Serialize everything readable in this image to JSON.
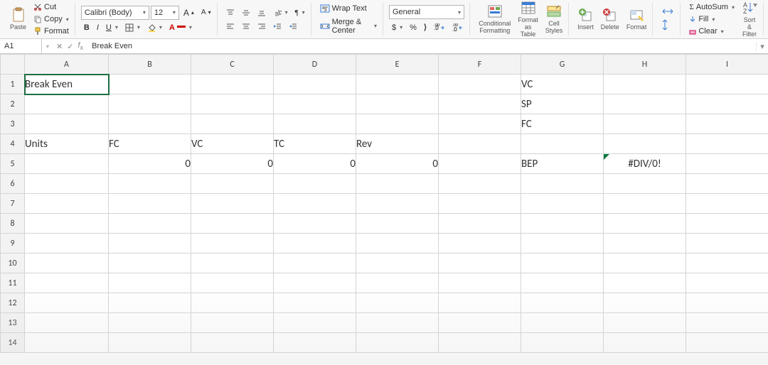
{
  "ribbon": {
    "clipboard": {
      "paste": "Paste",
      "cut": "Cut",
      "copy": "Copy",
      "format": "Format"
    },
    "font": {
      "name": "Calibri (Body)",
      "size": "12",
      "bold": "B",
      "italic": "I",
      "underline": "U",
      "increase": "A▴",
      "decrease": "A▾"
    },
    "align": {
      "wrap": "Wrap Text",
      "merge": "Merge & Center"
    },
    "number": {
      "format": "General",
      "currency": "$",
      "percent": "%",
      "comma": ",",
      "inc": ".00→.0",
      "dec": ".0→.00"
    },
    "styles": {
      "cond": "Conditional",
      "cond2": "Formatting",
      "fat": "Format",
      "fat2": "as Table",
      "cs": "Cell",
      "cs2": "Styles"
    },
    "cells": {
      "insert": "Insert",
      "delete": "Delete",
      "format": "Format"
    },
    "editing": {
      "autosum": "AutoSum",
      "fill": "Fill",
      "clear": "Clear",
      "sort": "Sort &",
      "filter": "Filter"
    }
  },
  "formula": {
    "cellref": "A1",
    "value": "Break Even"
  },
  "columns": [
    "A",
    "B",
    "C",
    "D",
    "E",
    "F",
    "G",
    "H",
    "I"
  ],
  "rows": [
    "1",
    "2",
    "3",
    "4",
    "5",
    "6",
    "7",
    "8",
    "9",
    "10",
    "11",
    "12",
    "13",
    "14"
  ],
  "cells": {
    "A1": "Break Even",
    "G1": "VC",
    "G2": "SP",
    "G3": "FC",
    "A4": "Units",
    "B4": "FC",
    "C4": "VC",
    "D4": "TC",
    "E4": "Rev",
    "B5": "0",
    "C5": "0",
    "D5": "0",
    "E5": "0",
    "G5": "BEP",
    "H5": "#DIV/0!"
  }
}
